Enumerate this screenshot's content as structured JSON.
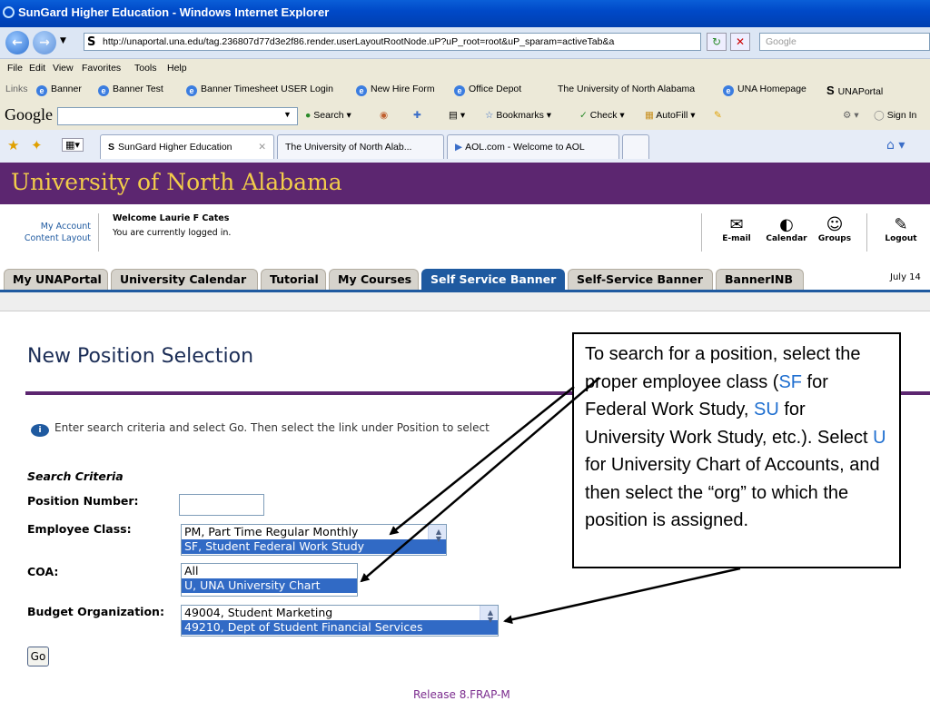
{
  "window": {
    "title": "SunGard Higher Education - Windows Internet Explorer"
  },
  "browser": {
    "address": "http://unaportal.una.edu/tag.236807d77d3e2f86.render.userLayoutRootNode.uP?uP_root=root&uP_sparam=activeTab&a",
    "search_placeholder": "Google",
    "menu": [
      "File",
      "Edit",
      "View",
      "Favorites",
      "Tools",
      "Help"
    ],
    "links_label": "Links",
    "links": [
      "Banner",
      "Banner Test",
      "Banner Timesheet USER Login",
      "New Hire Form",
      "Office Depot",
      "The University of North Alabama",
      "UNA Homepage",
      "UNAPortal"
    ],
    "google_toolbar": {
      "logo": "Google",
      "items": [
        "Search",
        "Bookmarks",
        "Check",
        "AutoFill"
      ],
      "sign_in": "Sign In"
    },
    "tabs": [
      "SunGard Higher Education",
      "The University of North Alab...",
      "AOL.com - Welcome to AOL"
    ]
  },
  "portal": {
    "name": "University of North Alabama",
    "account_links": [
      "My Account",
      "Content Layout"
    ],
    "welcome": "Welcome Laurie F Cates",
    "logged_in": "You are currently logged in.",
    "icons": [
      "E-mail",
      "Calendar",
      "Groups",
      "Logout"
    ],
    "tabs": [
      "My UNAPortal",
      "University Calendar",
      "Tutorial",
      "My Courses",
      "Self Service Banner",
      "Self-Service Banner",
      "BannerINB"
    ],
    "date": "July 14"
  },
  "form": {
    "title": "New Position Selection",
    "info": "Enter search criteria and select Go. Then select the link under Position to select",
    "section": "Search Criteria",
    "position_label": "Position Number:",
    "class_label": "Employee Class:",
    "class_options": [
      "PM, Part Time Regular Monthly",
      "SF, Student Federal Work Study"
    ],
    "coa_label": "COA:",
    "coa_options": [
      "All",
      "U, UNA University Chart"
    ],
    "org_label": "Budget Organization:",
    "org_options": [
      "49004, Student Marketing",
      "49210, Dept of Student Financial Services"
    ],
    "go": "Go"
  },
  "callout": {
    "p1": "To search for a position, select the proper employee class (",
    "sf": "SF",
    "p2": " for Federal Work Study, ",
    "su": "SU",
    "p3": " for University Work Study, etc.). Select ",
    "u": "U",
    "p4": " for University Chart of Accounts, and then select the “org” to which the position is assigned."
  },
  "footer_link": "Release 8.FRAP-M"
}
